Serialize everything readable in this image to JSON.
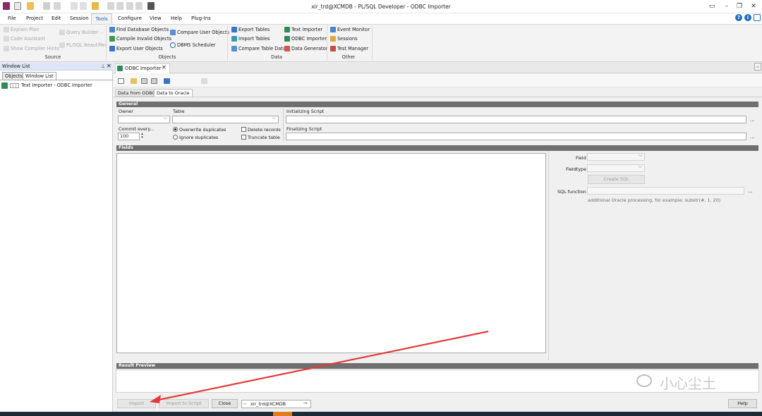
{
  "window": {
    "title": "xir_trd@XCMDB - PL/SQL Developer - ODBC Importer"
  },
  "menu": [
    "File",
    "Project",
    "Edit",
    "Session",
    "Tools",
    "Configure",
    "View",
    "Help",
    "Plug-Ins"
  ],
  "ribbon": {
    "source": {
      "label": "Source",
      "items": [
        "Explain Plan",
        "Code Assistant",
        "Show Compiler Hints",
        "Query Builder",
        "PL/SQL Beautifier"
      ]
    },
    "objects": {
      "label": "Objects",
      "items": [
        "Find Database Objects",
        "Compile Invalid Objects",
        "Export User Objects",
        "Compare User Objects",
        "DBMS Scheduler"
      ]
    },
    "data": {
      "label": "Data",
      "items": [
        "Export Tables",
        "Import Tables",
        "Compare Table Data",
        "Text Importer",
        "ODBC Importer",
        "Data Generator"
      ]
    },
    "other": {
      "label": "Other",
      "items": [
        "Event Monitor",
        "Sessions",
        "Test Manager"
      ]
    }
  },
  "left_pane": {
    "title": "Window List",
    "tabs": [
      "Objects",
      "Window List"
    ],
    "items": [
      "Text Importer - ODBC Importer"
    ]
  },
  "document": {
    "tab_label": "ODBC Importer",
    "sub_tabs": [
      "Data from ODBC",
      "Data to Oracle"
    ],
    "general": {
      "header": "General",
      "owner_label": "Owner",
      "table_label": "Table",
      "commit_label": "Commit every...",
      "commit_value": "100",
      "overwrite_label": "Overwrite duplicates",
      "ignore_label": "Ignore duplicates",
      "delete_label": "Delete records",
      "truncate_label": "Truncate table",
      "init_script_label": "Initializing Script",
      "final_script_label": "Finalizing Script",
      "ellipsis": "..."
    },
    "fields": {
      "header": "Fields",
      "field_label": "Field",
      "fieldtype_label": "Fieldtype",
      "create_sql": "Create SQL",
      "sql_function_label": "SQL function",
      "hint": "additional Oracle processing, for example: substr(#, 1, 20)"
    },
    "result_preview": {
      "header": "Result Preview"
    },
    "buttons": {
      "import": "Import",
      "import_to_script": "Import to Script",
      "close": "Close",
      "connection": "xir_trd@XCMDB",
      "help": "Help"
    }
  },
  "watermark": {
    "text": "小心尘土"
  },
  "colors": {
    "accent": "#1d5fb3",
    "section_header": "#6f6f6f",
    "arrow": "#e53a3a"
  }
}
